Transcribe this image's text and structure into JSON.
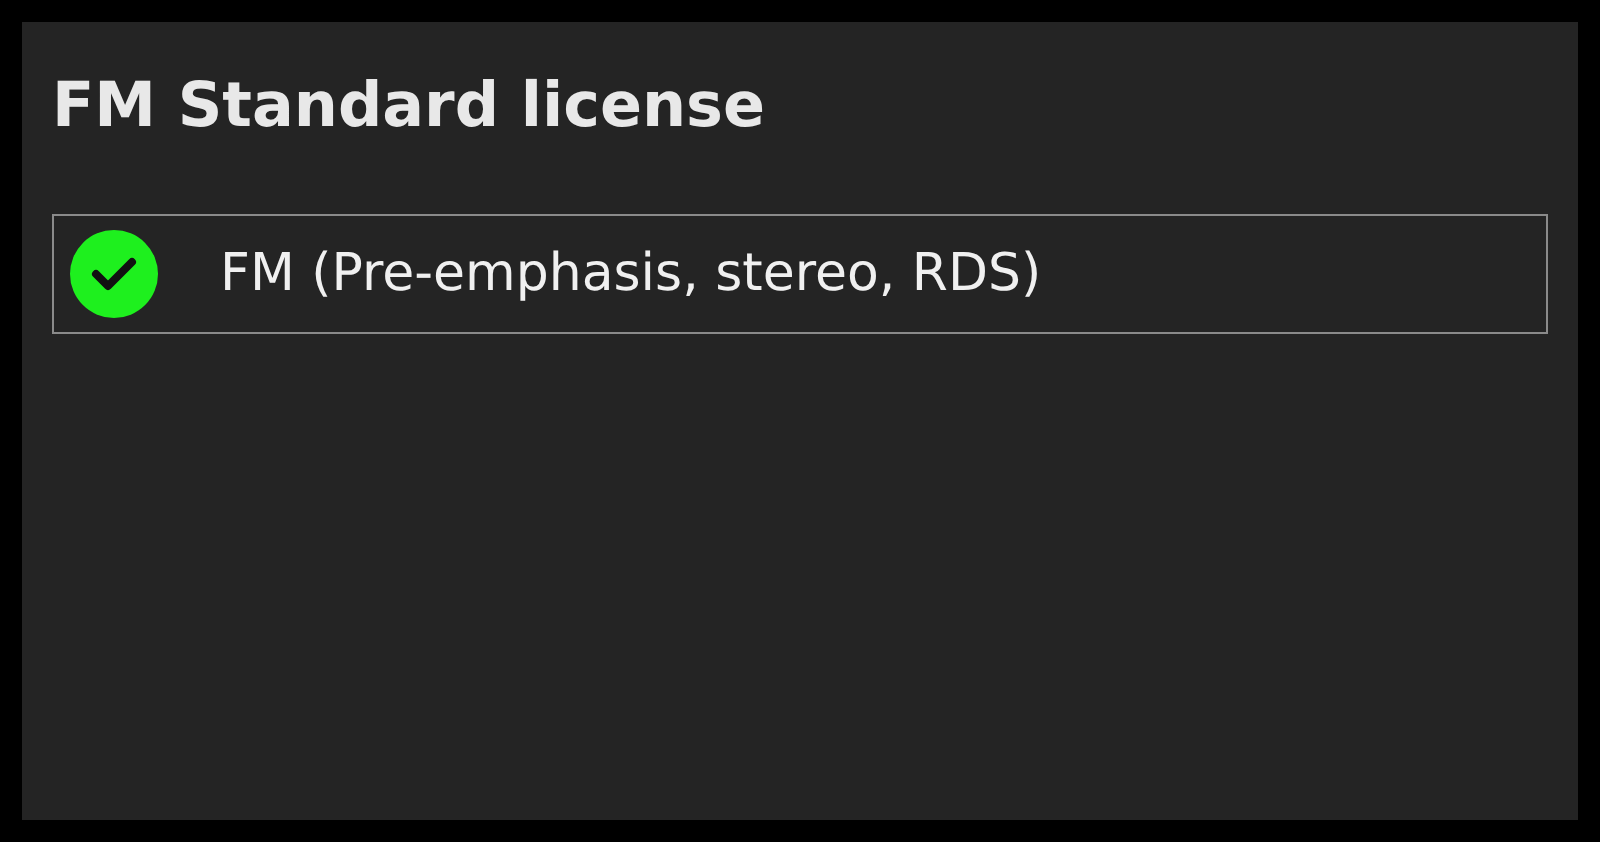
{
  "title": "FM Standard license",
  "features": [
    {
      "label": "FM (Pre-emphasis, stereo, RDS)",
      "enabled": true
    }
  ]
}
